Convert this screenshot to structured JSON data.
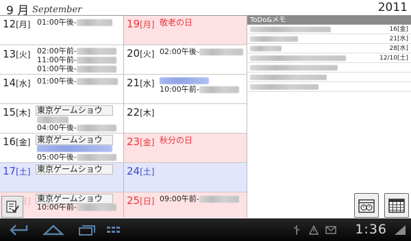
{
  "header": {
    "month_jp": "9 月",
    "month_en": "September",
    "year": "2011"
  },
  "days": {
    "d12": {
      "day": "12",
      "dow": "[月]",
      "events": [
        "01:00午後-"
      ]
    },
    "d13": {
      "day": "13",
      "dow": "[火]",
      "events": [
        "02:00午前-",
        "11:00午前-",
        "01:00午後-"
      ]
    },
    "d14": {
      "day": "14",
      "dow": "[水]",
      "events": [
        "01:00午後-"
      ]
    },
    "d15": {
      "day": "15",
      "dow": "[木]",
      "events": [
        "東京ゲームショウ",
        "04:00午後-"
      ]
    },
    "d16": {
      "day": "16",
      "dow": "[金]",
      "events": [
        "東京ゲームショウ",
        "05:00午後-"
      ]
    },
    "d17": {
      "day": "17",
      "dow": "[土]",
      "events": [
        "東京ゲームショウ"
      ]
    },
    "d18": {
      "day": "18",
      "dow": "[日]",
      "events": [
        "東京ゲームショウ",
        "10:00午前-"
      ]
    },
    "d19": {
      "day": "19",
      "dow": "[月]",
      "events": [
        "敬老の日"
      ]
    },
    "d20": {
      "day": "20",
      "dow": "[火]",
      "events": [
        "02:00午後-"
      ]
    },
    "d21": {
      "day": "21",
      "dow": "[水]",
      "events": [
        "10:00午前-"
      ]
    },
    "d22": {
      "day": "22",
      "dow": "[木]",
      "events": []
    },
    "d23": {
      "day": "23",
      "dow": "[金]",
      "events": [
        "秋分の日"
      ]
    },
    "d24": {
      "day": "24",
      "dow": "[土]",
      "events": []
    },
    "d25": {
      "day": "25",
      "dow": "[日]",
      "events": [
        "09:00午前-"
      ]
    }
  },
  "todo": {
    "title": "ToDo&メモ",
    "dates": [
      "16[金]",
      "21[水]",
      "28[水]",
      "12/10[土]"
    ]
  },
  "statusbar": {
    "clock": "1:36"
  },
  "icons": {
    "todo_list": "checklist-icon",
    "two_clocks": "dual-clock-icon",
    "calendar_grid": "calendar-grid-icon",
    "back": "back-icon",
    "home": "home-icon",
    "recent": "recent-apps-icon",
    "menu": "grid-menu-icon",
    "usb": "usb-icon",
    "alert": "alert-icon",
    "gmail": "gmail-icon",
    "wifi": "wifi-icon"
  },
  "colors": {
    "holiday_bg": "#fde1e3",
    "saturday_bg": "#e2e5fb",
    "red_text": "#e8353b",
    "blue_text": "#3848c8"
  }
}
